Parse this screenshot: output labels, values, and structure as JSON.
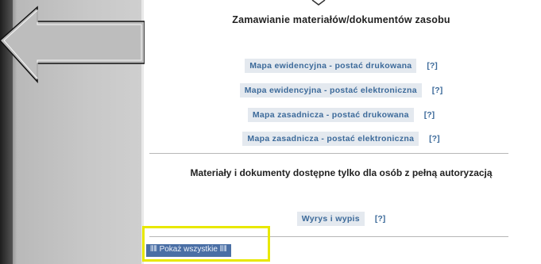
{
  "header": {
    "title": "Zamawianie materiałów/dokumentów zasobu"
  },
  "orders": [
    {
      "label": "Mapa ewidencyjna - postać drukowana",
      "help": "[?]"
    },
    {
      "label": "Mapa ewidencyjna - postać elektroniczna",
      "help": "[?]"
    },
    {
      "label": "Mapa zasadnicza - postać drukowana",
      "help": "[?]"
    },
    {
      "label": "Mapa zasadnicza - postać elektroniczna",
      "help": "[?]"
    }
  ],
  "restricted": {
    "heading": "Materiały i dokumenty dostępne tylko dla osób z pełną autoryzacją",
    "item": {
      "label": "Wyrys i wypis",
      "help": "[?]"
    }
  },
  "footer": {
    "show_all_label": "⦀⦀ Pokaż wszystkie ⦀⦀"
  },
  "colors": {
    "link": "#3c6a9a",
    "link_bg": "#e4e9ef",
    "highlight": "#e8e800",
    "button_bg": "#4a6fa5"
  },
  "icons": {
    "pointer": "left-arrow-icon"
  }
}
